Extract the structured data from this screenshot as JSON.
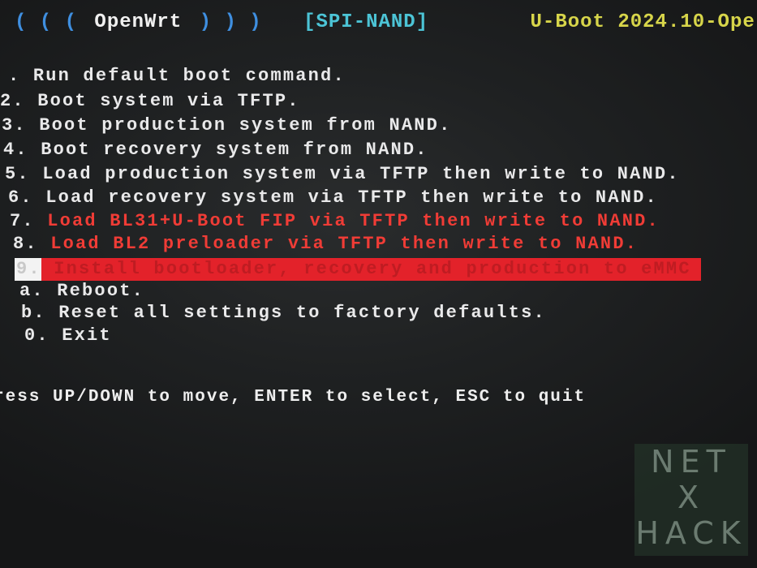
{
  "header": {
    "left_parens": "( ( (",
    "title": "OpenWrt",
    "right_parens": ") ) )",
    "flash": "[SPI-NAND]",
    "version": "U-Boot 2024.10-Ope"
  },
  "menu": {
    "items": [
      {
        "key": ".",
        "label": "Run default boot command.",
        "style": "normal"
      },
      {
        "key": "2.",
        "label": "Boot system via TFTP.",
        "style": "normal"
      },
      {
        "key": "3.",
        "label": "Boot production system from NAND.",
        "style": "normal"
      },
      {
        "key": "4.",
        "label": "Boot recovery system from NAND.",
        "style": "normal"
      },
      {
        "key": "5.",
        "label": "Load production system via TFTP then write to NAND.",
        "style": "normal"
      },
      {
        "key": "6.",
        "label": "Load recovery system via TFTP then write to NAND.",
        "style": "normal"
      },
      {
        "key": "7.",
        "label": "Load BL31+U-Boot FIP via TFTP then write to NAND.",
        "style": "warning"
      },
      {
        "key": "8.",
        "label": "Load BL2 preloader via TFTP then write to NAND.",
        "style": "warning"
      },
      {
        "key": "9.",
        "label": "Install bootloader, recovery and production to eMMC",
        "style": "selected"
      },
      {
        "key": "a.",
        "label": "Reboot.",
        "style": "normal"
      },
      {
        "key": "b.",
        "label": "Reset all settings to factory defaults.",
        "style": "normal"
      },
      {
        "key": "0.",
        "label": "Exit",
        "style": "normal"
      }
    ]
  },
  "prompt": "ress UP/DOWN to move, ENTER to select, ESC to quit",
  "watermark": {
    "line1": "NET",
    "line2": "X",
    "line3": "HACK"
  },
  "colors": {
    "background": "#1f2122",
    "text": "#e9e9ea",
    "warning": "#f03c36",
    "selection": "#e3222a",
    "header_blue": "#3f8fe0",
    "header_cyan": "#4cc4d6",
    "header_yellow": "#d7d54a"
  }
}
